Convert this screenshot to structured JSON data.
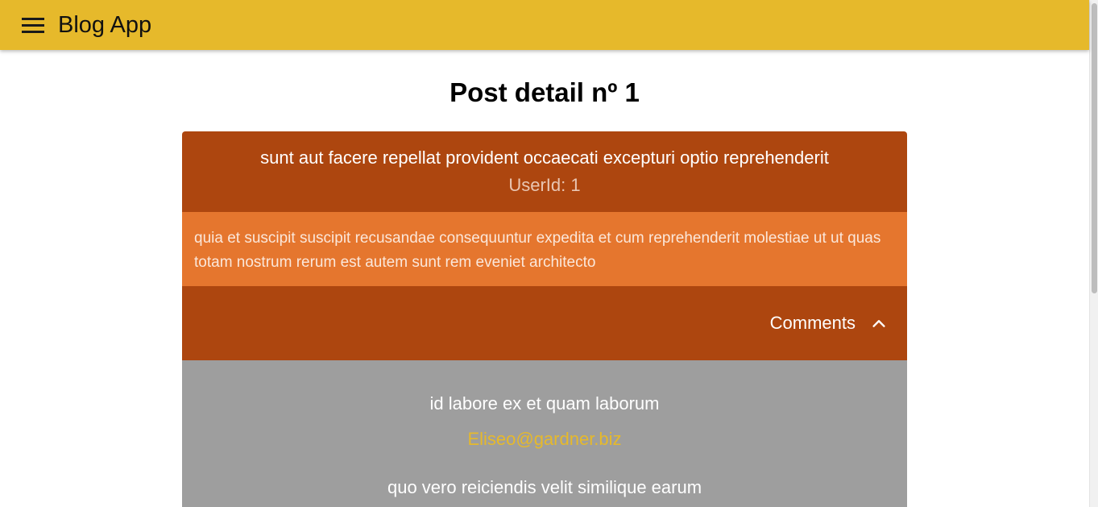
{
  "app": {
    "title": "Blog App",
    "menu_icon": "hamburger-menu-icon",
    "accent_color": "#e6b92b"
  },
  "page": {
    "title": "Post detail nº 1"
  },
  "post": {
    "title": "sunt aut facere repellat provident occaecati excepturi optio reprehenderit",
    "user_id_label": "UserId: 1",
    "body": "quia et suscipit suscipit recusandae consequuntur expedita et cum reprehenderit molestiae ut ut quas totam nostrum rerum est autem sunt rem eveniet architecto",
    "header_color": "#ad460f",
    "body_color": "#e5762e"
  },
  "comments_toggle": {
    "label": "Comments",
    "icon": "chevron-up-icon",
    "expanded": true
  },
  "comments": [
    {
      "name": "id labore ex et quam laborum",
      "email": "Eliseo@gardner.biz"
    },
    {
      "name": "quo vero reiciendis velit similique earum"
    }
  ]
}
